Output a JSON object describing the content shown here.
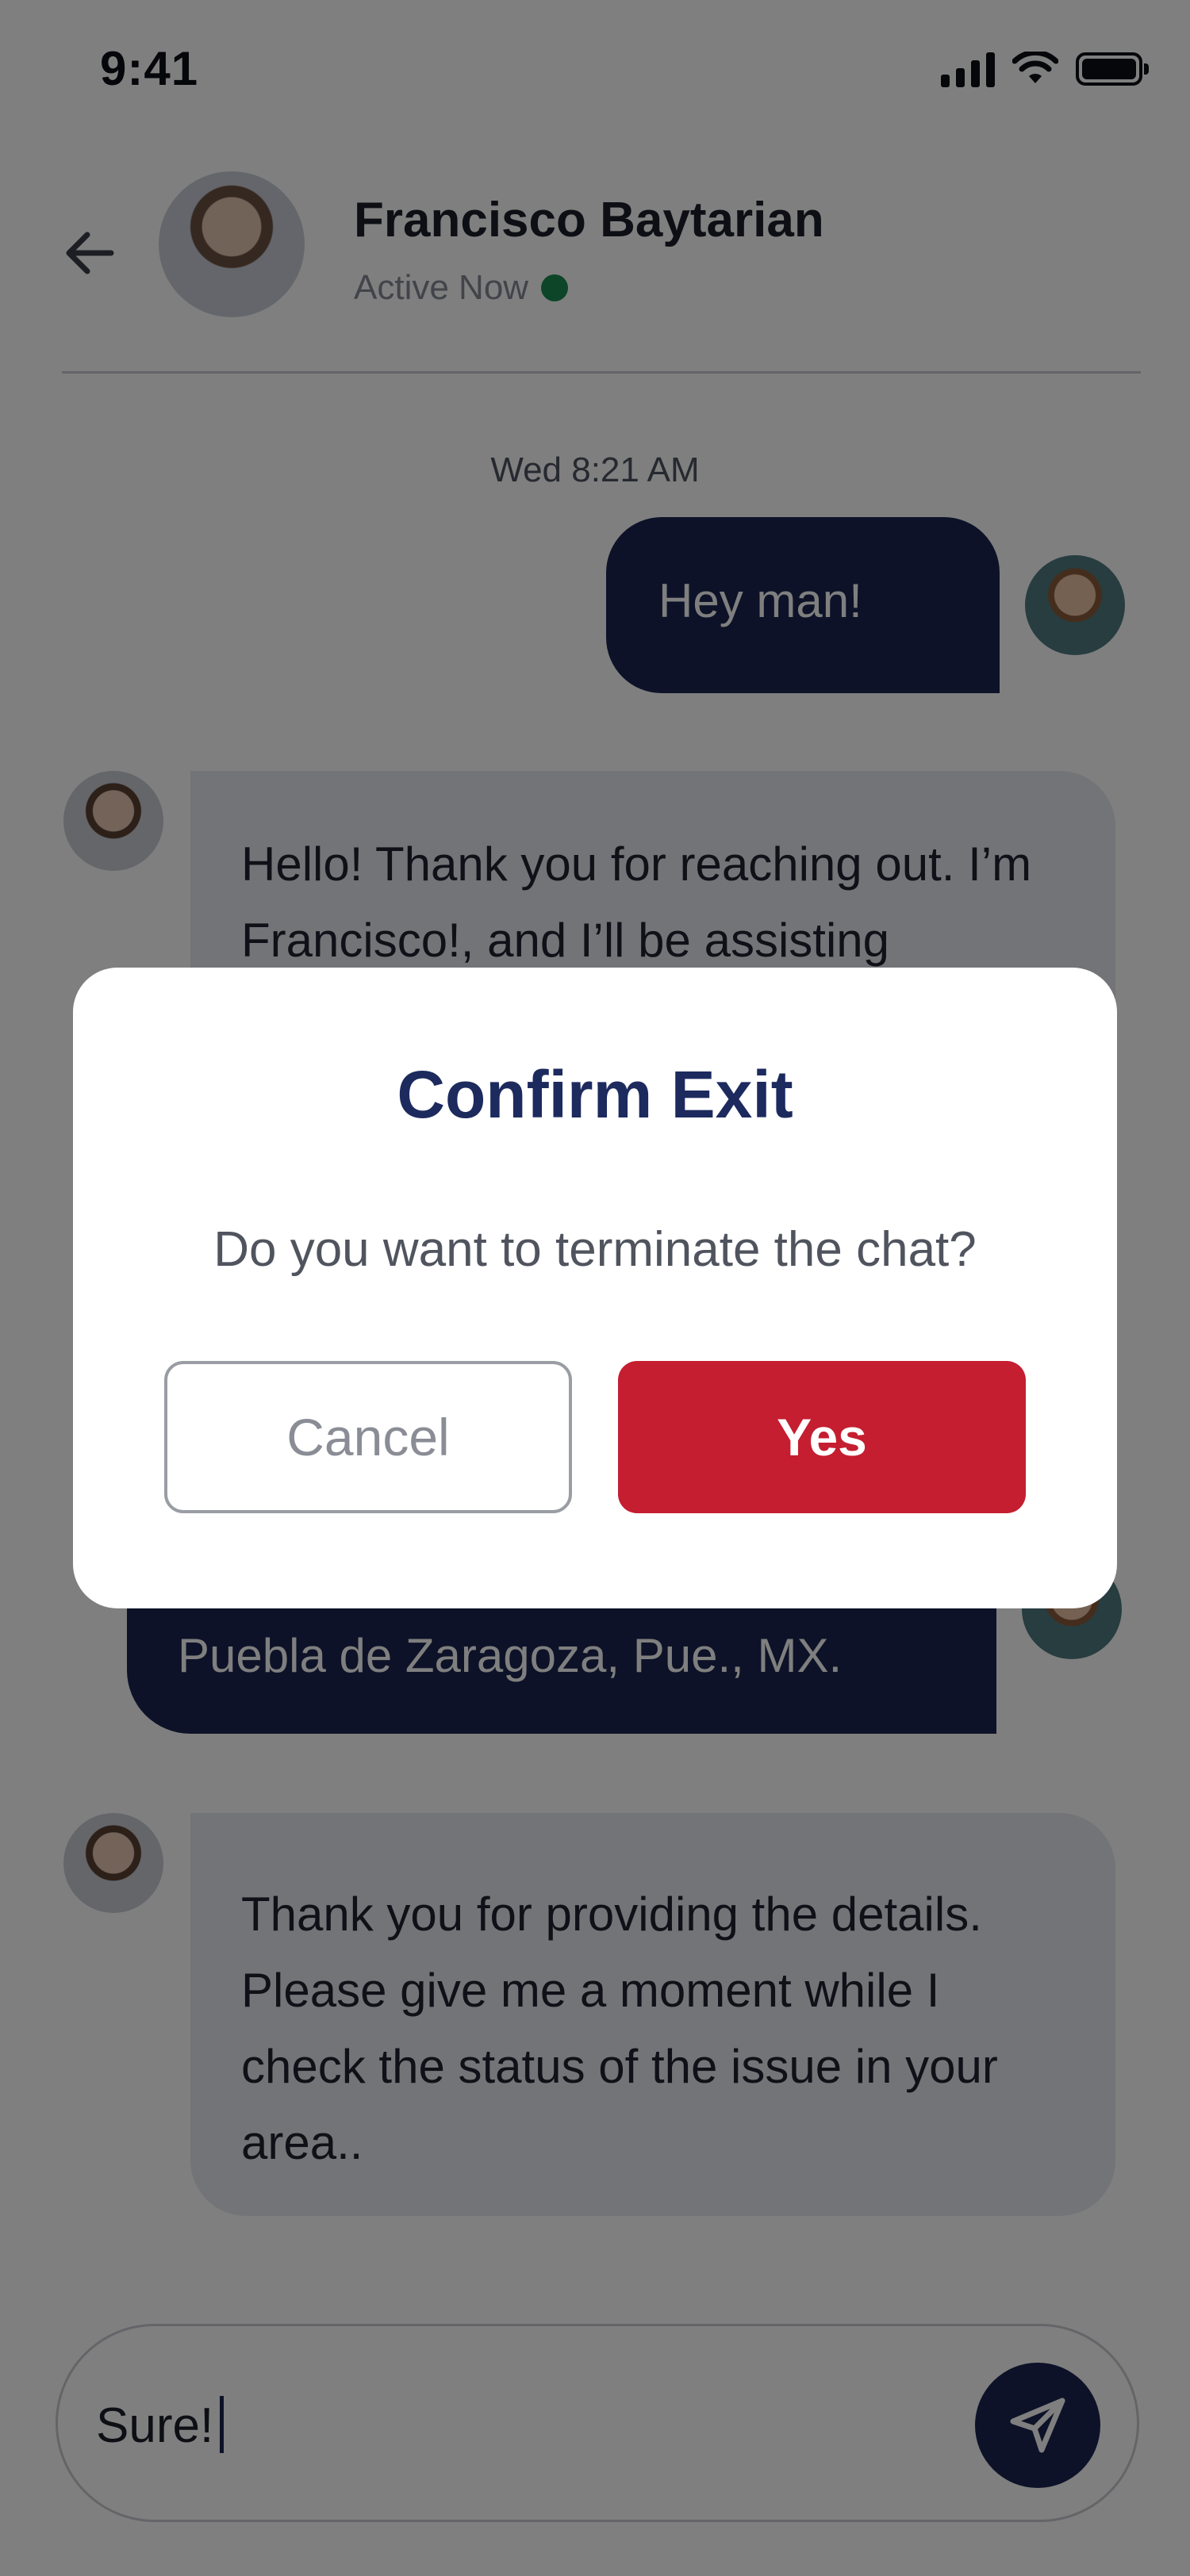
{
  "status_bar": {
    "time": "9:41"
  },
  "header": {
    "contact_name": "Francisco Baytarian",
    "status_text": "Active Now"
  },
  "chat": {
    "timestamp": "Wed 8:21 AM",
    "messages": [
      {
        "from": "user",
        "text": "Hey man!"
      },
      {
        "from": "agent",
        "text": "Hello!  Thank you for reaching out. I’m Francisco!, and I’ll be assisting"
      },
      {
        "from": "user",
        "text": "Puebla de Zaragoza, Pue., MX."
      },
      {
        "from": "agent",
        "text": "Thank you for providing the details. Please give me a moment while I check the status of the issue in your area.."
      }
    ]
  },
  "input": {
    "value": "Sure!"
  },
  "modal": {
    "title": "Confirm Exit",
    "message": "Do you want to terminate the chat?",
    "cancel_label": "Cancel",
    "confirm_label": "Yes"
  },
  "colors": {
    "sent_bubble": "#1b2450",
    "received_bubble": "#e6e8ee",
    "confirm_button": "#c41e30",
    "active_dot": "#1a8a50",
    "modal_title": "#1c2a5e"
  }
}
